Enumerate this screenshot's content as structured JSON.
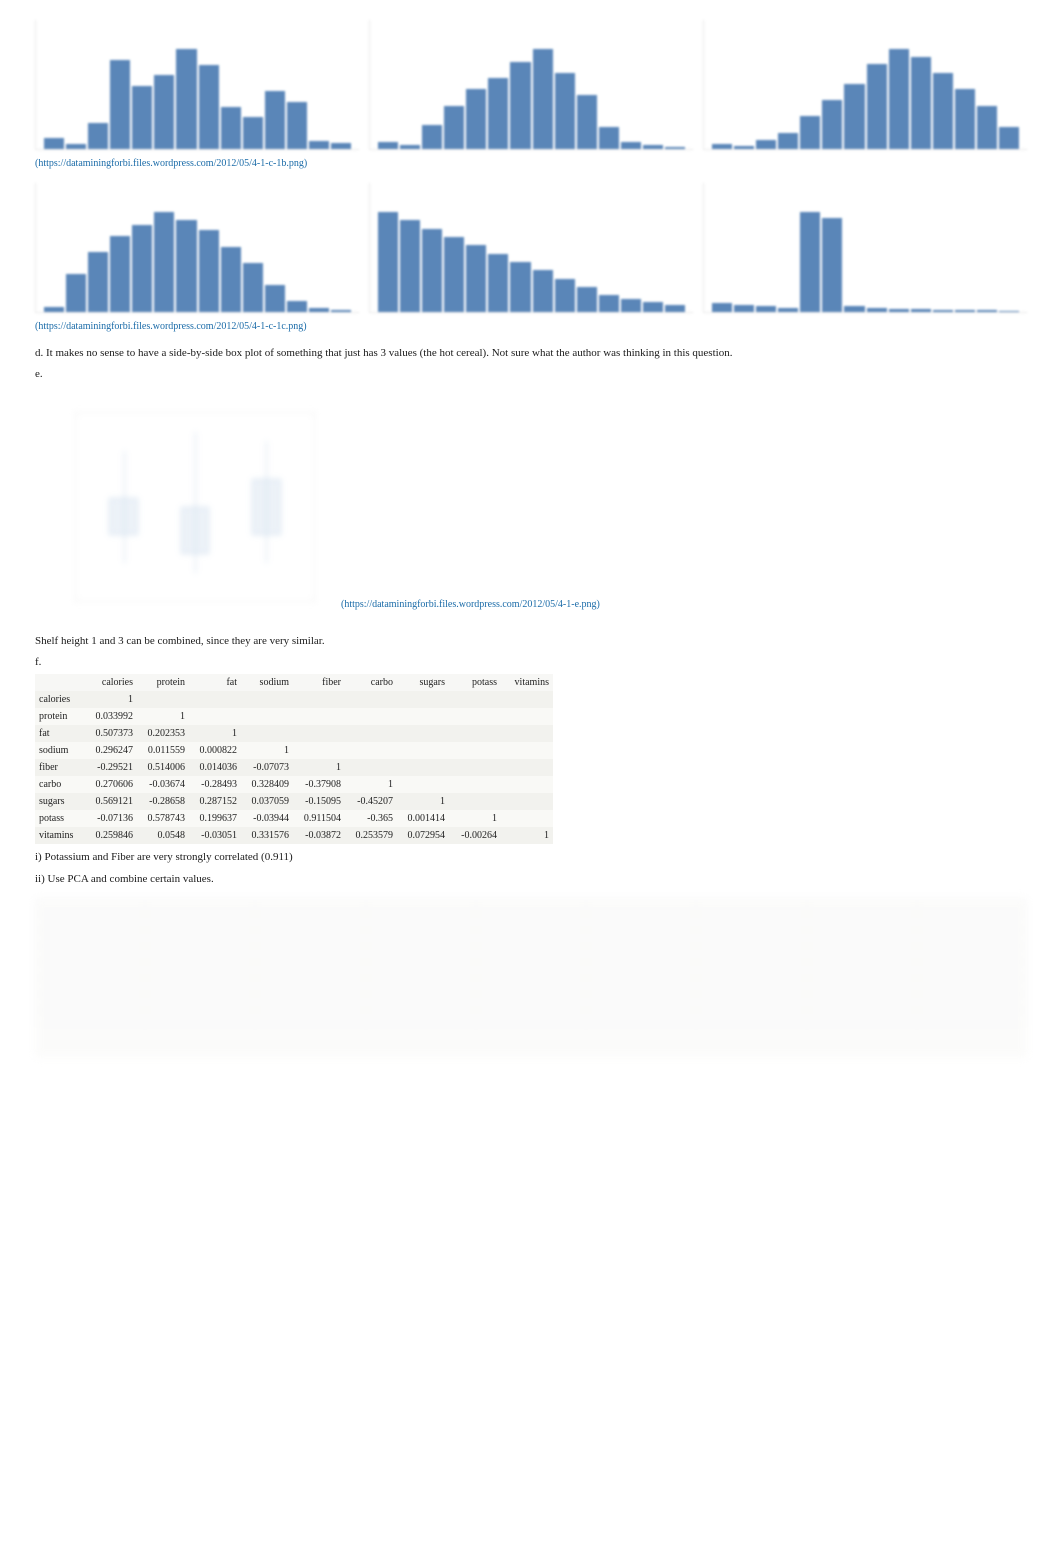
{
  "chartsTop": [
    {
      "title": "",
      "bars": [
        10,
        5,
        25,
        85,
        60,
        70,
        95,
        80,
        40,
        30,
        55,
        45,
        8,
        6
      ]
    },
    {
      "title": "",
      "bars": [
        6,
        4,
        22,
        40,
        55,
        65,
        80,
        92,
        70,
        50,
        20,
        6,
        4,
        2
      ]
    },
    {
      "title": "",
      "bars": [
        5,
        3,
        8,
        15,
        30,
        45,
        60,
        78,
        92,
        85,
        70,
        55,
        40,
        20
      ]
    }
  ],
  "link1": "(https://dataminingforbi.files.wordpress.com/2012/05/4-1-c-1b.png)",
  "chartsBottom": [
    {
      "title": "",
      "bars": [
        5,
        35,
        55,
        70,
        80,
        92,
        85,
        75,
        60,
        45,
        25,
        10,
        4,
        2
      ]
    },
    {
      "title": "",
      "bars": [
        60,
        55,
        50,
        45,
        40,
        35,
        30,
        25,
        20,
        15,
        10,
        8,
        6,
        4
      ]
    },
    {
      "title": "",
      "bars": [
        8,
        6,
        5,
        4,
        90,
        85,
        5,
        4,
        3,
        3,
        2,
        2,
        2,
        1
      ]
    }
  ],
  "link2": "(https://dataminingforbi.files.wordpress.com/2012/05/4-1-c-1c.png)",
  "para_d": "d. It makes no sense to have a side-by-side box plot of something that just has 3 values (the hot cereal). Not sure what the author was thinking in this question.",
  "label_e": "e.",
  "boxplot_title": "",
  "link3": "(https://dataminingforbi.files.wordpress.com/2012/05/4-1-e.png)",
  "para_shelf": "Shelf height 1 and 3 can be combined, since they are very similar.",
  "label_f": "f.",
  "corr": {
    "headers": [
      "",
      "calories",
      "protein",
      "fat",
      "sodium",
      "fiber",
      "carbo",
      "sugars",
      "potass",
      "vitamins"
    ],
    "rows": [
      [
        "calories",
        "1",
        "",
        "",
        "",
        "",
        "",
        "",
        "",
        ""
      ],
      [
        "protein",
        "0.033992",
        "1",
        "",
        "",
        "",
        "",
        "",
        "",
        ""
      ],
      [
        "fat",
        "0.507373",
        "0.202353",
        "1",
        "",
        "",
        "",
        "",
        "",
        ""
      ],
      [
        "sodium",
        "0.296247",
        "0.011559",
        "0.000822",
        "1",
        "",
        "",
        "",
        "",
        ""
      ],
      [
        "fiber",
        "-0.29521",
        "0.514006",
        "0.014036",
        "-0.07073",
        "1",
        "",
        "",
        "",
        ""
      ],
      [
        "carbo",
        "0.270606",
        "-0.03674",
        "-0.28493",
        "0.328409",
        "-0.37908",
        "1",
        "",
        "",
        ""
      ],
      [
        "sugars",
        "0.569121",
        "-0.28658",
        "0.287152",
        "0.037059",
        "-0.15095",
        "-0.45207",
        "1",
        "",
        ""
      ],
      [
        "potass",
        "-0.07136",
        "0.578743",
        "0.199637",
        "-0.03944",
        "0.911504",
        "-0.365",
        "0.001414",
        "1",
        ""
      ],
      [
        "vitamins",
        "0.259846",
        "0.0548",
        "-0.03051",
        "0.331576",
        "-0.03872",
        "0.253579",
        "0.072954",
        "-0.00264",
        "1"
      ]
    ]
  },
  "para_fi": "i) Potassium and Fiber are very strongly correlated (0.911)",
  "para_fii": "ii) Use PCA and combine certain values.",
  "chart_data": [
    {
      "type": "bar",
      "title": "",
      "categories": [],
      "values": [
        10,
        5,
        25,
        85,
        60,
        70,
        95,
        80,
        40,
        30,
        55,
        45,
        8,
        6
      ],
      "note": "blurred histogram, values estimated by bar height"
    },
    {
      "type": "bar",
      "title": "",
      "categories": [],
      "values": [
        6,
        4,
        22,
        40,
        55,
        65,
        80,
        92,
        70,
        50,
        20,
        6,
        4,
        2
      ],
      "note": "blurred histogram"
    },
    {
      "type": "bar",
      "title": "",
      "categories": [],
      "values": [
        5,
        3,
        8,
        15,
        30,
        45,
        60,
        78,
        92,
        85,
        70,
        55,
        40,
        20
      ],
      "note": "blurred histogram"
    },
    {
      "type": "bar",
      "title": "",
      "categories": [],
      "values": [
        5,
        35,
        55,
        70,
        80,
        92,
        85,
        75,
        60,
        45,
        25,
        10,
        4,
        2
      ],
      "note": "blurred histogram"
    },
    {
      "type": "bar",
      "title": "",
      "categories": [],
      "values": [
        60,
        55,
        50,
        45,
        40,
        35,
        30,
        25,
        20,
        15,
        10,
        8,
        6,
        4
      ],
      "note": "blurred histogram"
    },
    {
      "type": "bar",
      "title": "",
      "categories": [],
      "values": [
        8,
        6,
        5,
        4,
        90,
        85,
        5,
        4,
        3,
        3,
        2,
        2,
        2,
        1
      ],
      "note": "blurred histogram"
    },
    {
      "type": "boxplot",
      "title": "",
      "groups": 3,
      "note": "blurred side-by-side box plot, 3 groups, values not legible"
    }
  ]
}
